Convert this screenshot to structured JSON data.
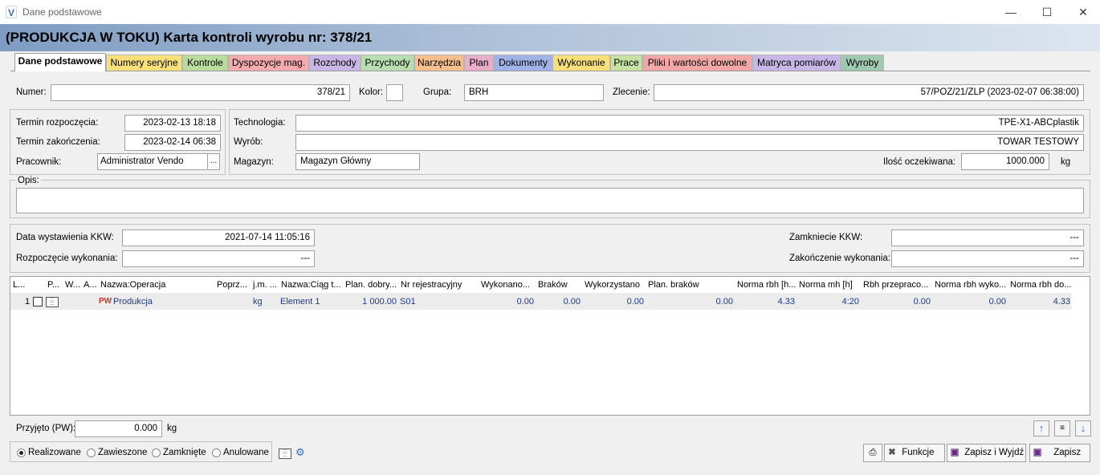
{
  "window": {
    "title": "Dane podstawowe",
    "icon_letter": "V"
  },
  "page_title": "(PRODUKCJA W TOKU) Karta kontroli wyrobu nr: 378/21",
  "tabs": [
    {
      "label": "Dane podstawowe",
      "color": "#ffffff"
    },
    {
      "label": "Numery seryjne",
      "color": "#f7e07a"
    },
    {
      "label": "Kontrole",
      "color": "#b9dc9c"
    },
    {
      "label": "Dyspozycje mag.",
      "color": "#f5aab0"
    },
    {
      "label": "Rozchody",
      "color": "#c9b6e6"
    },
    {
      "label": "Przychody",
      "color": "#b8ddb0"
    },
    {
      "label": "Narzędzia",
      "color": "#f6c08e"
    },
    {
      "label": "Plan",
      "color": "#e8aec8"
    },
    {
      "label": "Dokumenty",
      "color": "#9fb3e6"
    },
    {
      "label": "Wykonanie",
      "color": "#f7e07a"
    },
    {
      "label": "Prace",
      "color": "#c7e0a4"
    },
    {
      "label": "Pliki i wartości dowolne",
      "color": "#f2a7a7"
    },
    {
      "label": "Matryca pomiarów",
      "color": "#c7b6e6"
    },
    {
      "label": "Wyroby",
      "color": "#9fcab0"
    }
  ],
  "top": {
    "numer_label": "Numer:",
    "numer": "378/21",
    "kolor_label": "Kolor:",
    "grupa_label": "Grupa:",
    "grupa": "BRH",
    "zlecenie_label": "Zlecenie:",
    "zlecenie": "57/POZ/21/ZLP  (2023-02-07 06:38:00)"
  },
  "left_box": {
    "start_label": "Termin rozpoczęcia:",
    "start": "2023-02-13 18:18",
    "end_label": "Termin zakończenia:",
    "end": "2023-02-14 06:38",
    "worker_label": "Pracownik:",
    "worker": "Administrator Vendo",
    "ellipsis": "..."
  },
  "right_box": {
    "tech_label": "Technologia:",
    "tech": "TPE-X1-ABCplastik",
    "product_label": "Wyrób:",
    "product": "TOWAR TESTOWY",
    "warehouse_label": "Magazyn:",
    "warehouse": "Magazyn Główny",
    "qty_label": "Ilość oczekiwana:",
    "qty": "1000.000",
    "qty_unit": "kg"
  },
  "opis": {
    "label": "Opis:",
    "value": ""
  },
  "kkw": {
    "issue_label": "Data wystawienia KKW:",
    "issue": "2021-07-14 11:05:16",
    "close_label": "Zamkniecie KKW:",
    "close": "---",
    "exec_start_label": "Rozpoczęcie wykonania:",
    "exec_start": "---",
    "exec_end_label": "Zakończenie wykonania:",
    "exec_end": "---"
  },
  "grid": {
    "headers": [
      "L...",
      "P...",
      "W...",
      "A...",
      "Nazwa:Operacja",
      "Poprz...",
      "j.m. ...",
      "Nazwa:Ciąg t...",
      "Plan. dobry...",
      "Nr rejestracyjny",
      "Wykonano...",
      "Braków",
      "Wykorzystano",
      "Plan. braków",
      "Norma rbh [h...",
      "Norma mh [h]",
      "Rbh przepraco...",
      "Norma rbh wyko...",
      "Norma rbh do..."
    ],
    "rows": [
      {
        "lp": "1",
        "tag": "PW",
        "operation": "Produkcja",
        "unit": "kg",
        "chain": "Element 1",
        "plan_good": "1 000.00",
        "reg_no": "S01",
        "done": "0.00",
        "rejects": "0.00",
        "used": "0.00",
        "plan_rejects": "0.00",
        "norm_rbh": "4.33",
        "norm_mh": "4:20",
        "rbh_worked": "0.00",
        "norm_rbh_exec": "0.00",
        "norm_rbh_do": "4.33"
      }
    ]
  },
  "bottom": {
    "accepted_label": "Przyjęto (PW):",
    "accepted": "0.000",
    "accepted_unit": "kg",
    "status": [
      {
        "label": "Realizowane",
        "selected": true
      },
      {
        "label": "Zawieszone",
        "selected": false
      },
      {
        "label": "Zamknięte",
        "selected": false
      },
      {
        "label": "Anulowane",
        "selected": false
      }
    ],
    "functions_label": "Funkcje",
    "save_exit_label": "Zapisz i Wyjdź",
    "save_label": "Zapisz"
  }
}
